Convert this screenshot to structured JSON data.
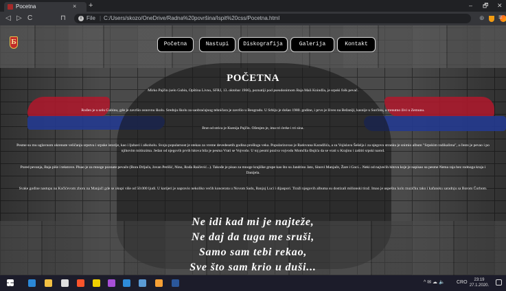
{
  "browser": {
    "tab_title": "Pocetna",
    "tab_close": "×",
    "new_tab": "+",
    "window_min": "–",
    "window_max": "🗗",
    "window_close": "✕",
    "back": "◁",
    "forward": "▷",
    "reload": "C",
    "bookmark": "⊓",
    "url_scheme": "File",
    "url_sep": "|",
    "url": "C:/Users/skozo/OneDrive/Radna%20površina/Ispit%20css/Pocetna.html",
    "zoom_icon": "⊕",
    "menu_icon": "≡"
  },
  "site": {
    "logo_char": "Б",
    "nav": [
      {
        "label": "Početna"
      },
      {
        "label": "Nastupi"
      },
      {
        "label": "Diskografija"
      },
      {
        "label": "Galerija"
      },
      {
        "label": "Kontakt"
      }
    ],
    "title": "POČETNA",
    "paragraphs": [
      "Mirko Pajčin (selo Gubin, Opština Livno, SFRJ, 13. oktobar 1966), poznatiji pod pseudonimom Baja Mali Knindža, je srpski folk pevač.",
      "Rođen je u selu Gubinu, gde je završio osnovnu školu. Srednju školu za saobraćajnog tehničara je završio u Beogradu. U Srbiju je došao 1980. godine, i prvo je živeo na Bežaniji, kasnije u Surčinu, a trenutno živi u Zemunu.",
      "Brat od strica je Ksenija Pajčin. Oženjen je, ima tri ćerke i tri sina.",
      "Pesme su mu uglavnom okrenute veličanju srpstva i srpske istorije, kao i ljubavi i alkoholu. Svoju popularnost je stekao za vreme devedesetih godina prošloga veka. Popularizovao je Radovana Karadžića, a za Vojislava Šešelja i za njegovu stranku je snimio album \"Srpskim radikalima\", a često je pevao i po njihovim mitinzima. Jedan od njegovih prvih hitova bila je pesma Vrati se Vojvodo. U toj pesmi poziva vojvodu Momčila Đujića da se vrati u Krajinu i zaštiti srpski narod.",
      "Pored pevanja, Baja piše i tekstove. Pisao je za mnoge poznate pevače (Bora Drljača, Jovan Perišić, Nino, Rođa Raičević...). Takođe je pisao za mnoge krajiške grupe kao što su Jandrino Jato, Sinovi Manjače, Žare i Goci... Neki od najvećih hitova koje je napisao su pesme Nema raja bez rodnoga kraja i Danijela.",
      "Svake godine nastupa na Kočićevom zboru na Manjači gde se okupi više od 50.000 ljudi. U karijeri je napravio nekoliko većih koncerata u Novom Sadu, Banjoj Luci i dijaspori. Tiraži njegovih albuma su dostizali milionski tiraž. Imao je uspešnu kolo muzičku tako i kafansku saradnju sa Borom Čorbom."
    ],
    "lyrics": [
      "Ne idi kad mi je najteže,",
      "Ne daj da tuga me sruši,",
      "Samo sam tebi rekao,",
      "Sve što sam krio u duši..."
    ]
  },
  "taskbar": {
    "tray_lang": "CRO",
    "tray_icons": "^ ✉ ☁ 🔈",
    "clock_time": "23:19",
    "clock_date": "27.1.2020."
  },
  "colors": {
    "flag_red": "#b0182c",
    "flag_blue": "#233a8f",
    "nav_bg": "#000000",
    "text": "#ffffff"
  }
}
